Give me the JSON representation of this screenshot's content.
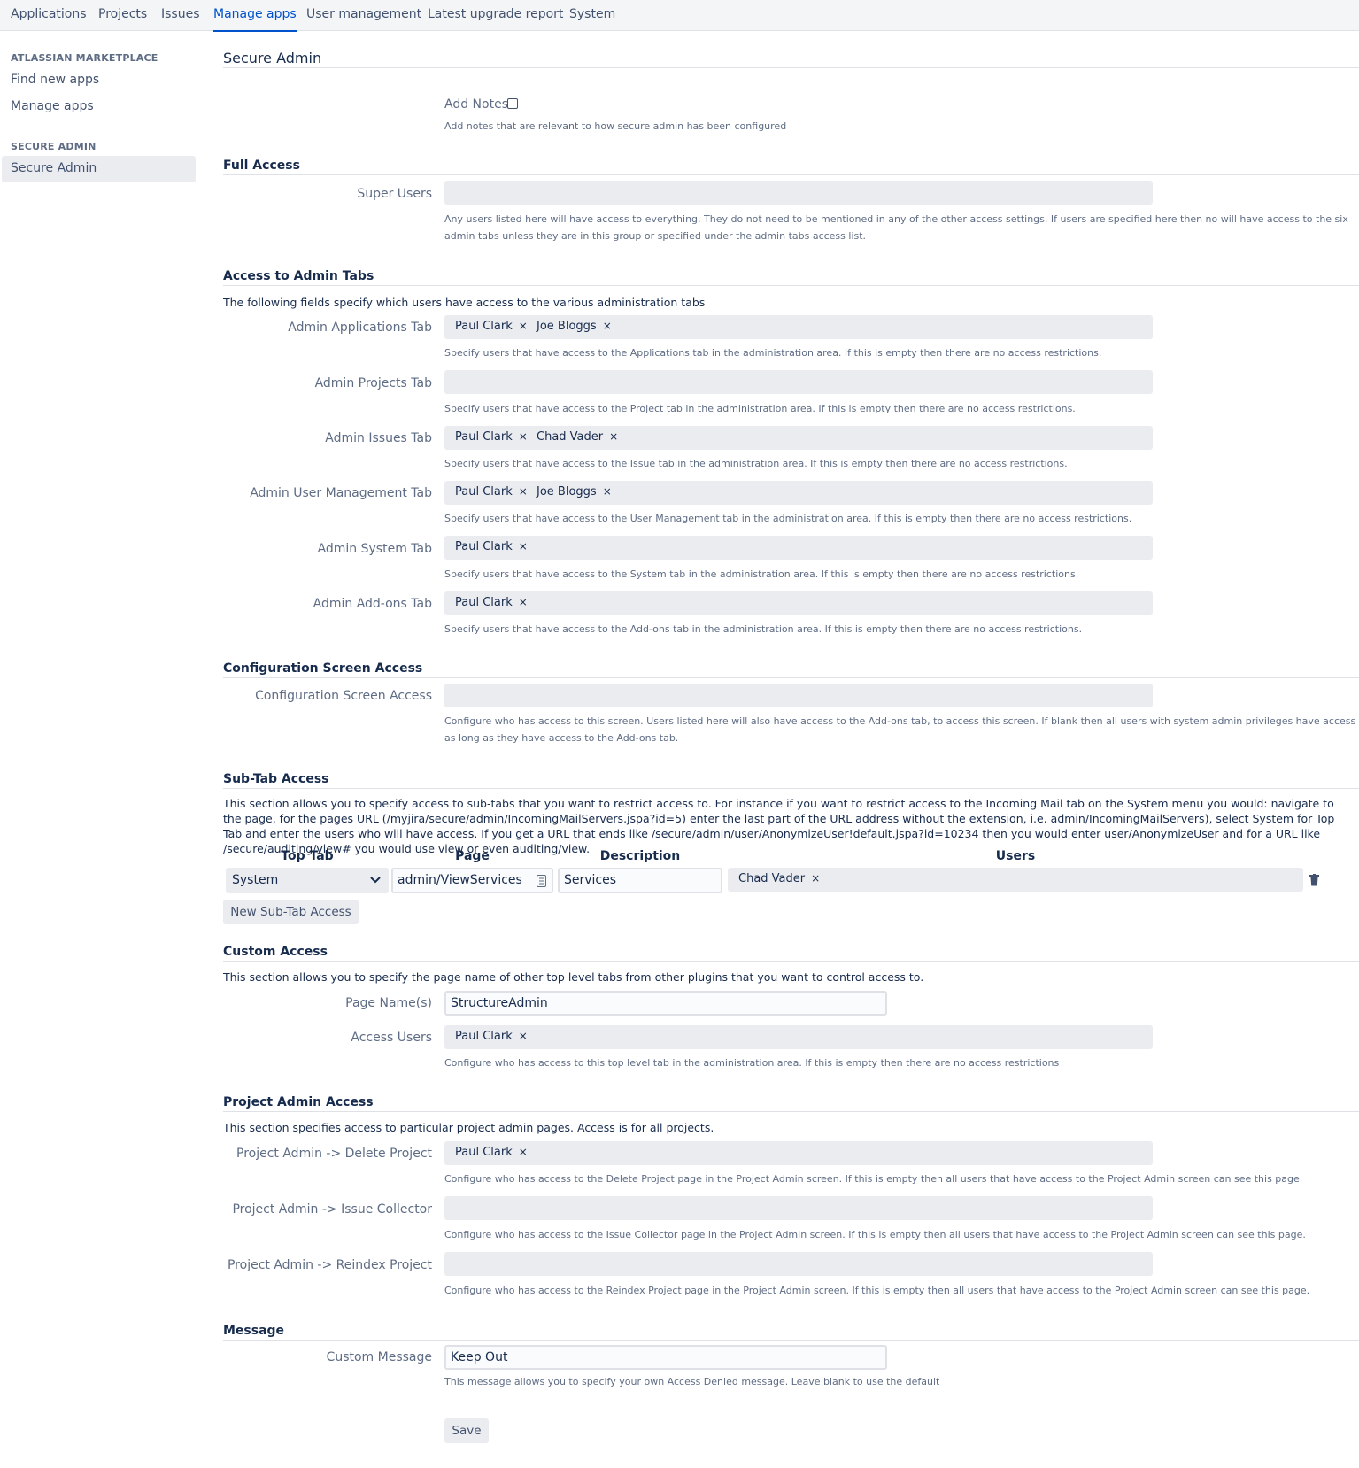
{
  "topnav": {
    "tabs": [
      {
        "label": "Applications"
      },
      {
        "label": "Projects"
      },
      {
        "label": "Issues"
      },
      {
        "label": "Manage apps"
      },
      {
        "label": "User management"
      },
      {
        "label": "Latest upgrade report"
      },
      {
        "label": "System"
      }
    ]
  },
  "sidebar": {
    "marketplace_heading": "ATLASSIAN MARKETPLACE",
    "find_new_apps": "Find new apps",
    "manage_apps": "Manage apps",
    "secure_admin_heading": "SECURE ADMIN",
    "secure_admin": "Secure Admin"
  },
  "page": {
    "title": "Secure Admin",
    "add_notes_label": "Add Notes",
    "add_notes_desc": "Add notes that are relevant to how secure admin has been configured"
  },
  "full_access": {
    "heading": "Full Access",
    "super_users_label": "Super Users",
    "super_users_desc": "Any users listed here will have access to everything. They do not need to be mentioned in any of the other access settings. If users are specified here then no will have access to the six admin tabs unless they are in this group or specified under the admin tabs access list."
  },
  "admin_tabs": {
    "heading": "Access to Admin Tabs",
    "intro": "The following fields specify which users have access to the various administration tabs",
    "fields": [
      {
        "label": "Admin Applications Tab",
        "users": [
          "Paul Clark",
          "Joe Bloggs"
        ],
        "desc": "Specify users that have access to the Applications tab in the administration area. If this is empty then there are no access restrictions."
      },
      {
        "label": "Admin Projects Tab",
        "users": [],
        "desc": "Specify users that have access to the Project tab in the administration area. If this is empty then there are no access restrictions."
      },
      {
        "label": "Admin Issues Tab",
        "users": [
          "Paul Clark",
          "Chad Vader"
        ],
        "desc": "Specify users that have access to the Issue tab in the administration area. If this is empty then there are no access restrictions."
      },
      {
        "label": "Admin User Management Tab",
        "users": [
          "Paul Clark",
          "Joe Bloggs"
        ],
        "desc": "Specify users that have access to the User Management tab in the administration area. If this is empty then there are no access restrictions."
      },
      {
        "label": "Admin System Tab",
        "users": [
          "Paul Clark"
        ],
        "desc": "Specify users that have access to the System tab in the administration area. If this is empty then there are no access restrictions."
      },
      {
        "label": "Admin Add-ons Tab",
        "users": [
          "Paul Clark"
        ],
        "desc": "Specify users that have access to the Add-ons tab in the administration area. If this is empty then there are no access restrictions."
      }
    ]
  },
  "config_screen": {
    "heading": "Configuration Screen Access",
    "label": "Configuration Screen Access",
    "desc": "Configure who has access to this screen. Users listed here will also have access to the Add-ons tab, to access this screen. If blank then all users with system admin privileges have access as long as they have access to the Add-ons tab."
  },
  "subtab": {
    "heading": "Sub-Tab Access",
    "intro": "This section allows you to specify access to sub-tabs that you want to restrict access to. For instance if you want to restrict access to the Incoming Mail tab on the System menu you would: navigate to the page, for the pages URL (/myjira/secure/admin/IncomingMailServers.jspa?id=5) enter the last part of the URL address without the extension, i.e. admin/IncomingMailServers), select System for Top Tab and enter the users who will have access. If you get a URL that ends like /secure/admin/user/AnonymizeUser!default.jspa?id=10234 then you would enter user/AnonymizeUser and for a URL like /secure/auditing/view# you would use view or even auditing/view.",
    "col_top_tab": "Top Tab",
    "col_page": "Page",
    "col_description": "Description",
    "col_users": "Users",
    "row": {
      "top_tab": "System",
      "page": "admin/ViewServices",
      "description": "Services",
      "users": [
        "Chad Vader"
      ]
    },
    "new_button": "New Sub-Tab Access"
  },
  "custom_access": {
    "heading": "Custom Access",
    "intro": "This section allows you to specify the page name of other top level tabs from other plugins that you want to control access to.",
    "page_names_label": "Page Name(s)",
    "page_names_value": "StructureAdmin",
    "access_users_label": "Access Users",
    "access_users": [
      "Paul Clark"
    ],
    "desc": "Configure who has access to this top level tab in the administration area. If this is empty then there are no access restrictions"
  },
  "project_admin": {
    "heading": "Project Admin Access",
    "intro": "This section specifies access to particular project admin pages. Access is for all projects.",
    "fields": [
      {
        "label": "Project Admin -> Delete Project",
        "users": [
          "Paul Clark"
        ],
        "desc": "Configure who has access to the Delete Project page in the Project Admin screen. If this is empty then all users that have access to the Project Admin screen can see this page."
      },
      {
        "label": "Project Admin -> Issue Collector",
        "users": [],
        "desc": "Configure who has access to the Issue Collector page in the Project Admin screen. If this is empty then all users that have access to the Project Admin screen can see this page."
      },
      {
        "label": "Project Admin -> Reindex Project",
        "users": [],
        "desc": "Configure who has access to the Reindex Project page in the Project Admin screen. If this is empty then all users that have access to the Project Admin screen can see this page."
      }
    ]
  },
  "message": {
    "heading": "Message",
    "label": "Custom Message",
    "value": "Keep Out",
    "desc": "This message allows you to specify your own Access Denied message. Leave blank to use the default",
    "save_button": "Save"
  }
}
